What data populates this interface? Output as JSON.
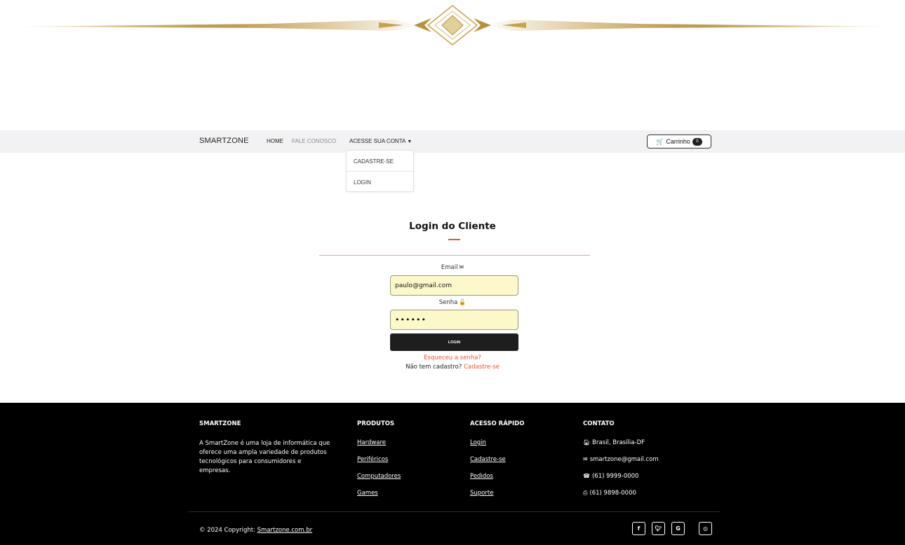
{
  "navbar": {
    "brand": "SMARTZONE",
    "links": {
      "home": "HOME",
      "contact": "FALE CONOSCO",
      "account": "ACESSE SUA CONTA"
    },
    "cart": {
      "label": "Carrinho",
      "count": "0"
    }
  },
  "dropdown": {
    "items": [
      "CADASTRE-SE",
      "LOGIN"
    ]
  },
  "login": {
    "title": "Login do Cliente",
    "email_label": "Email",
    "email_value": "paulo@gmail.com",
    "password_label": "Senha",
    "password_value": "123456",
    "submit_label": "LOGIN",
    "forgot_label": "Esqueceu a senha?",
    "no_account_text": "Não tem cadastro?",
    "signup_label": "Cadastre-se"
  },
  "footer": {
    "about": {
      "heading": "SMARTZONE",
      "description": "A SmartZone é uma loja de informática que oferece uma ampla variedade de produtos tecnológicos para consumidores e empresas."
    },
    "products": {
      "heading": "PRODUTOS",
      "links": [
        "Hardware",
        "Periféricos",
        "Computadores",
        "Games"
      ]
    },
    "quick_access": {
      "heading": "ACESSO RÁPIDO",
      "links": [
        "Login",
        "Cadastre-se",
        "Pedidos",
        "Suporte"
      ]
    },
    "contact": {
      "heading": "CONTATO",
      "address": "Brasil, Brasília-DF",
      "email": "smartzone@gmail.com",
      "phone": "(61) 9999-0000",
      "fax": "(61) 9898-0000"
    },
    "copyright_prefix": "© 2024 Copyright:",
    "copyright_link": "Smartzone.com.br",
    "social": [
      "facebook-icon",
      "twitter-icon",
      "google-icon",
      "instagram-icon"
    ]
  },
  "colors": {
    "accent": "#e8553a",
    "input_bg": "#fdf8c9",
    "footer_bg": "#000000",
    "navbar_bg": "#f2f2f4",
    "gold": "#c9a24a"
  }
}
